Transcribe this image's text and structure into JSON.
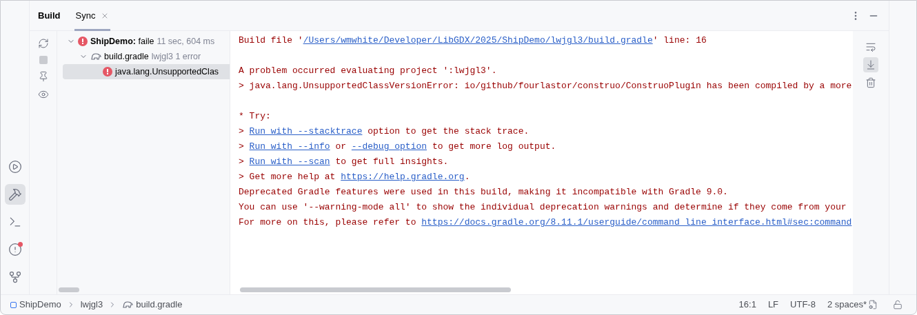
{
  "tool_window": {
    "title": "Build",
    "tabs": [
      {
        "label": "Sync",
        "selected": true
      }
    ]
  },
  "left_stripe": [
    {
      "kind": "run",
      "selected": false,
      "alert": false
    },
    {
      "kind": "build",
      "selected": true,
      "alert": false
    },
    {
      "kind": "terminal",
      "selected": false,
      "alert": false
    },
    {
      "kind": "problems",
      "selected": false,
      "alert": true
    },
    {
      "kind": "git",
      "selected": false,
      "alert": false
    }
  ],
  "actions": [
    {
      "kind": "rerun",
      "disabled": false
    },
    {
      "kind": "stop",
      "disabled": true
    },
    {
      "kind": "pin",
      "disabled": false
    },
    {
      "kind": "eye",
      "disabled": false
    }
  ],
  "tree": [
    {
      "kind": "error",
      "label": "**ShipDemo:** faile",
      "detail": "11 sec, 604 ms",
      "expanded": true,
      "selected": false,
      "children": [
        {
          "kind": "file",
          "label": "build.gradle",
          "detail": "lwjgl3 1 error",
          "expanded": true,
          "selected": false,
          "children": [
            {
              "kind": "error",
              "label": "java.lang.UnsupportedClas",
              "selected": true
            }
          ]
        }
      ]
    }
  ],
  "console": [
    {
      "kind": "text",
      "segments": [
        {
          "text": "Build file '",
          "link": false
        },
        {
          "text": "/Users/wmwhite/Developer/LibGDX/2025/ShipDemo/lwjgl3/build.gradle",
          "link": true
        },
        {
          "text": "' line: 16",
          "link": false
        }
      ]
    },
    {
      "kind": "blank"
    },
    {
      "kind": "text",
      "segments": [
        {
          "text": "A problem occurred evaluating project ':lwjgl3'.",
          "link": false
        }
      ]
    },
    {
      "kind": "text",
      "segments": [
        {
          "text": "> java.lang.UnsupportedClassVersionError: io/github/fourlastor/construo/ConstruoPlugin has been compiled by a more",
          "link": false
        }
      ]
    },
    {
      "kind": "blank"
    },
    {
      "kind": "text",
      "segments": [
        {
          "text": "* Try:",
          "link": false
        }
      ]
    },
    {
      "kind": "text",
      "segments": [
        {
          "text": "> ",
          "link": false
        },
        {
          "text": "Run with --stacktrace",
          "link": true
        },
        {
          "text": " option to get the stack trace.",
          "link": false
        }
      ]
    },
    {
      "kind": "text",
      "segments": [
        {
          "text": "> ",
          "link": false
        },
        {
          "text": "Run with --info",
          "link": true
        },
        {
          "text": " or ",
          "link": false
        },
        {
          "text": "--debug option",
          "link": true
        },
        {
          "text": " to get more log output.",
          "link": false
        }
      ]
    },
    {
      "kind": "text",
      "segments": [
        {
          "text": "> ",
          "link": false
        },
        {
          "text": "Run with --scan",
          "link": true
        },
        {
          "text": " to get full insights.",
          "link": false
        }
      ]
    },
    {
      "kind": "text",
      "segments": [
        {
          "text": "> Get more help at ",
          "link": false
        },
        {
          "text": "https://help.gradle.org",
          "link": true
        },
        {
          "text": ".",
          "link": false
        }
      ]
    },
    {
      "kind": "text",
      "segments": [
        {
          "text": "Deprecated Gradle features were used in this build, making it incompatible with Gradle 9.0.",
          "link": false
        }
      ]
    },
    {
      "kind": "text",
      "segments": [
        {
          "text": "You can use '--warning-mode all' to show the individual deprecation warnings and determine if they come from your",
          "link": false
        }
      ]
    },
    {
      "kind": "text",
      "segments": [
        {
          "text": "For more on this, please refer to ",
          "link": false
        },
        {
          "text": "https://docs.gradle.org/8.11.1/userguide/command_line_interface.html#sec:command",
          "link": true
        }
      ]
    }
  ],
  "console_actions": [
    {
      "kind": "wrap",
      "selected": false
    },
    {
      "kind": "scroll_end",
      "selected": true
    },
    {
      "kind": "trash",
      "selected": false
    }
  ],
  "status_bar": {
    "breadcrumbs": [
      {
        "kind": "module",
        "label": "ShipDemo"
      },
      {
        "kind": "folder",
        "label": "lwjgl3"
      },
      {
        "kind": "file",
        "label": "build.gradle"
      }
    ],
    "items": [
      {
        "kind": "text",
        "label": "16:1"
      },
      {
        "kind": "text",
        "label": "LF"
      },
      {
        "kind": "text",
        "label": "UTF-8"
      },
      {
        "kind": "indent",
        "label": "2 spaces*"
      },
      {
        "kind": "lock"
      }
    ]
  }
}
